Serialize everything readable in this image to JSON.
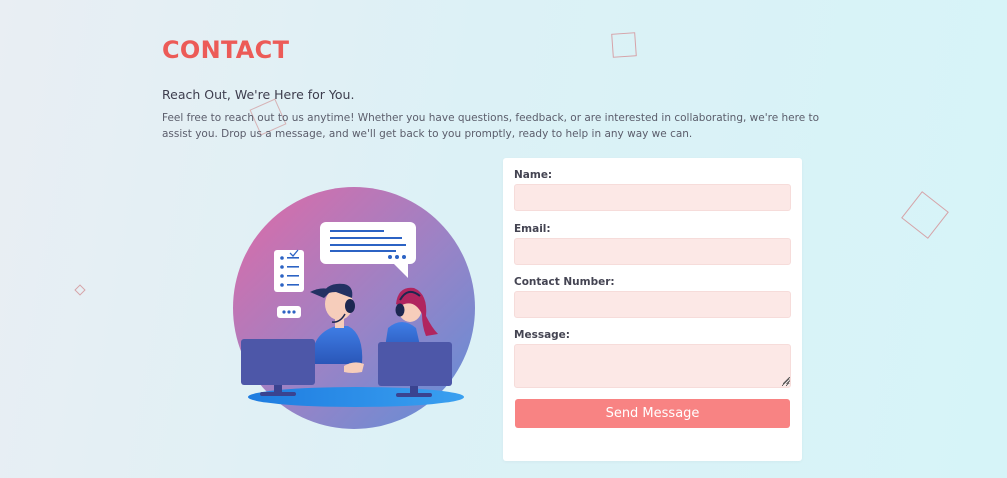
{
  "page": {
    "title": "CONTACT",
    "subtitle": "Reach Out, We're Here for You.",
    "intro": "Feel free to reach out to us anytime! Whether you have questions, feedback, or are interested in collaborating, we're here to assist you. Drop us a message, and we'll get back to you promptly, ready to help in any way we can."
  },
  "illustration": {
    "icon": "customer-support-agents-illustration"
  },
  "form": {
    "name_label": "Name:",
    "name_value": "",
    "email_label": "Email:",
    "email_value": "",
    "contact_label": "Contact Number:",
    "contact_value": "",
    "message_label": "Message:",
    "message_value": "",
    "submit_label": "Send Message"
  },
  "colors": {
    "accent": "#ec5b57",
    "button": "#f88383",
    "field_bg": "#fce8e6"
  }
}
